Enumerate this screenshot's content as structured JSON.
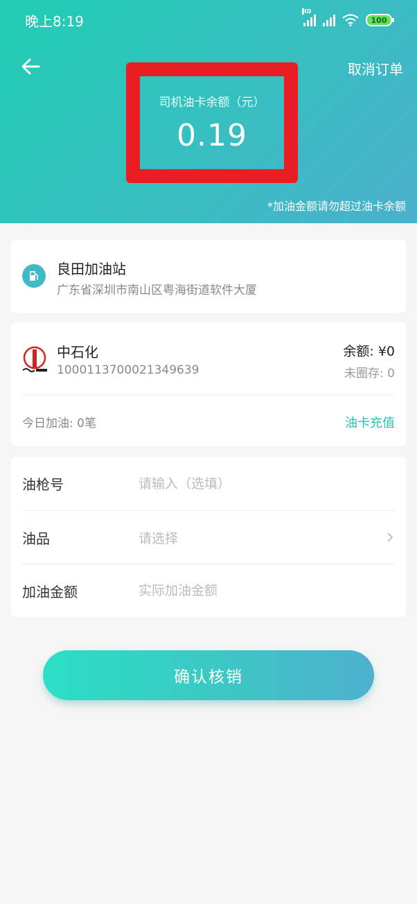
{
  "status_bar": {
    "time": "晚上8:19",
    "network_label": "HD",
    "battery": "100"
  },
  "header": {
    "cancel_label": "取消订单",
    "balance_label": "司机油卡余额（元）",
    "balance_value": "0.19",
    "notice": "*加油金额请勿超过油卡余额",
    "gradient_colors": [
      "#20cdb2",
      "#4bb0cc"
    ],
    "highlight_color": "#ea1c24"
  },
  "station": {
    "name": "良田加油站",
    "address": "广东省深圳市南山区粤海街道软件大厦",
    "icon": "fuel-pump-icon"
  },
  "card": {
    "brand": "中石化",
    "logo": "sinopec-logo",
    "number": "1000113700021349639",
    "balance": "余额: ¥0",
    "uncirculated": "未圈存: 0",
    "today_refuel": "今日加油: 0笔",
    "recharge_label": "油卡充值"
  },
  "form": {
    "nozzle_label": "油枪号",
    "nozzle_placeholder": "请输入（选填）",
    "fuel_label": "油品",
    "fuel_placeholder": "请选择",
    "amount_label": "加油金额",
    "amount_placeholder": "实际加油金额"
  },
  "confirm_button": "确认核销"
}
